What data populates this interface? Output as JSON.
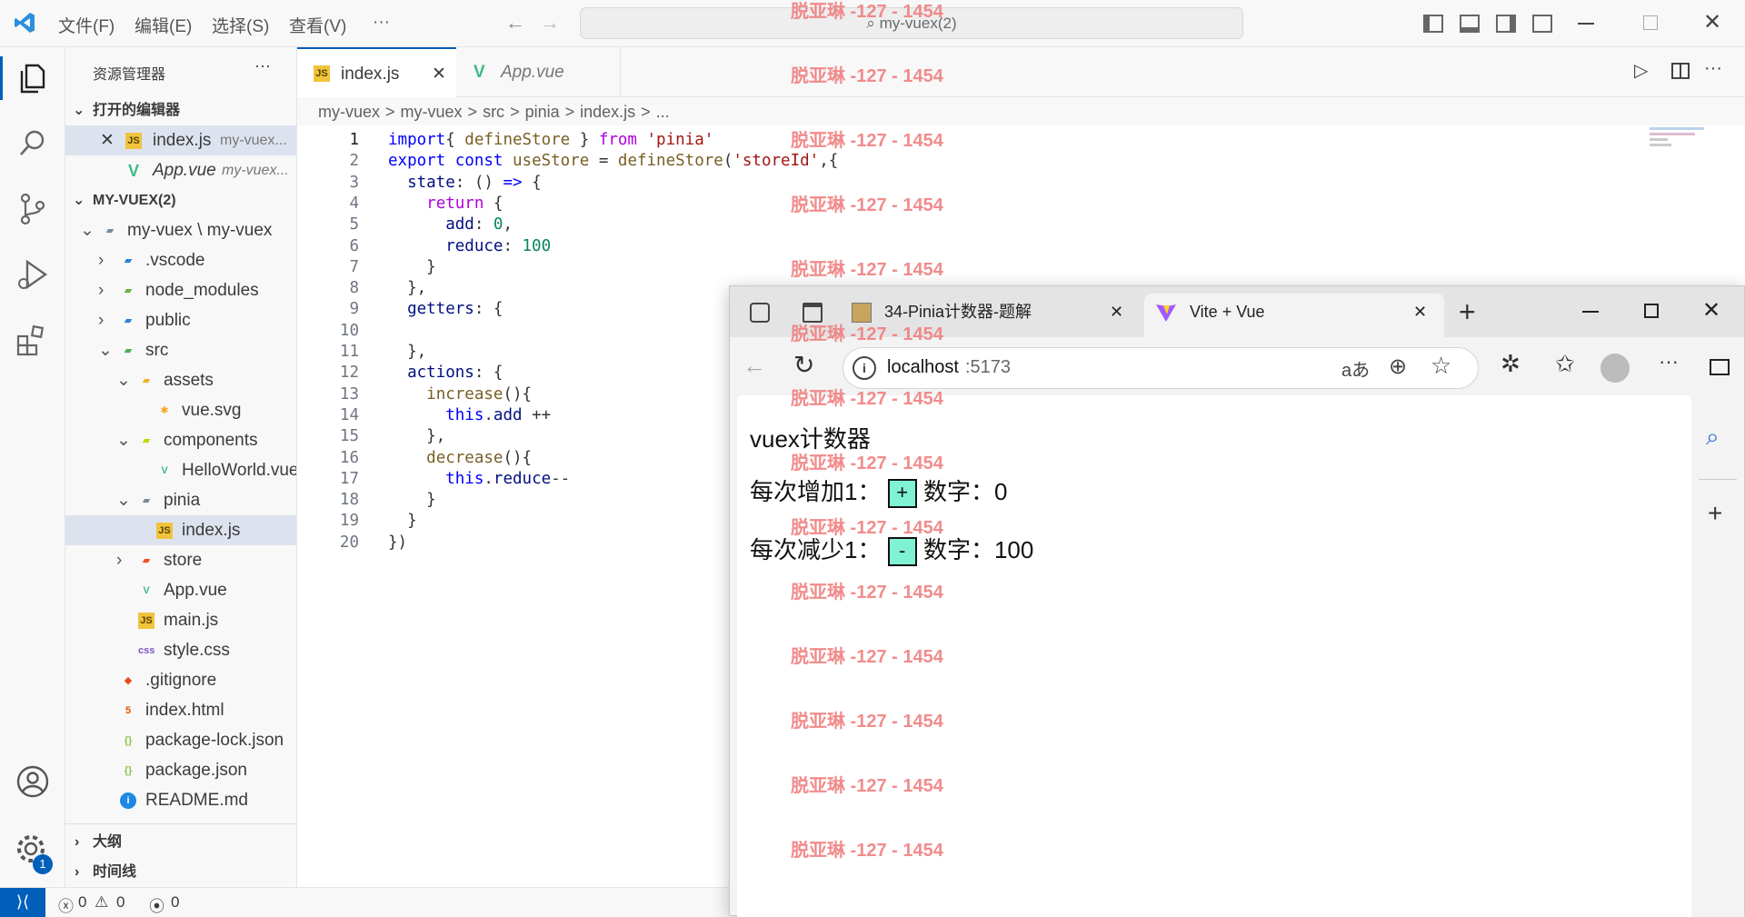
{
  "titlebar": {
    "menus": [
      "文件(F)",
      "编辑(E)",
      "选择(S)",
      "查看(V)",
      "···"
    ],
    "search": "my-vuex(2)"
  },
  "sidebar": {
    "title": "资源管理器",
    "more": "···",
    "open_editors_header": "打开的编辑器",
    "open_editors": [
      {
        "name": "index.js",
        "path": "my-vuex..."
      },
      {
        "name": "App.vue",
        "path": "my-vuex..."
      }
    ],
    "project_header": "MY-VUEX(2)",
    "tree": [
      {
        "label": "my-vuex \\ my-vuex",
        "depth": 1,
        "chev": "v",
        "icon": "folder",
        "color": "#7a8b99"
      },
      {
        "label": ".vscode",
        "depth": 2,
        "chev": ">",
        "icon": "folder",
        "color": "#2f7fd8"
      },
      {
        "label": "node_modules",
        "depth": 2,
        "chev": ">",
        "icon": "folder",
        "color": "#6cb33f"
      },
      {
        "label": "public",
        "depth": 2,
        "chev": ">",
        "icon": "folder",
        "color": "#2f7fd8"
      },
      {
        "label": "src",
        "depth": 2,
        "chev": "v",
        "icon": "folder",
        "color": "#4caf50"
      },
      {
        "label": "assets",
        "depth": 3,
        "chev": "v",
        "icon": "folder",
        "color": "#f0b429"
      },
      {
        "label": "vue.svg",
        "depth": 4,
        "chev": "",
        "icon": "star",
        "color": "#f5a623"
      },
      {
        "label": "components",
        "depth": 3,
        "chev": "v",
        "icon": "folder",
        "color": "#c4d600"
      },
      {
        "label": "HelloWorld.vue",
        "depth": 4,
        "chev": "",
        "icon": "vue",
        "color": "#41b883"
      },
      {
        "label": "pinia",
        "depth": 3,
        "chev": "v",
        "icon": "folder",
        "color": "#7a8b99"
      },
      {
        "label": "index.js",
        "depth": 4,
        "chev": "",
        "icon": "js",
        "color": "#f0c33c",
        "selected": true
      },
      {
        "label": "store",
        "depth": 3,
        "chev": ">",
        "icon": "folder",
        "color": "#f4511e"
      },
      {
        "label": "App.vue",
        "depth": 3,
        "chev": "",
        "icon": "vue",
        "color": "#41b883"
      },
      {
        "label": "main.js",
        "depth": 3,
        "chev": "",
        "icon": "js",
        "color": "#f0c33c"
      },
      {
        "label": "style.css",
        "depth": 3,
        "chev": "",
        "icon": "css",
        "color": "#7e57c2"
      },
      {
        "label": ".gitignore",
        "depth": 2,
        "chev": "",
        "icon": "git",
        "color": "#e64a19"
      },
      {
        "label": "index.html",
        "depth": 2,
        "chev": "",
        "icon": "html",
        "color": "#e65100"
      },
      {
        "label": "package-lock.json",
        "depth": 2,
        "chev": "",
        "icon": "json",
        "color": "#8bc34a"
      },
      {
        "label": "package.json",
        "depth": 2,
        "chev": "",
        "icon": "json",
        "color": "#8bc34a"
      },
      {
        "label": "README.md",
        "depth": 2,
        "chev": "",
        "icon": "info",
        "color": "#1e88e5"
      }
    ],
    "outline": "大纲",
    "timeline": "时间线"
  },
  "editor": {
    "tabs": [
      {
        "label": "index.js",
        "active": true
      },
      {
        "label": "App.vue",
        "active": false
      }
    ],
    "breadcrumb": [
      "my-vuex",
      ">",
      "my-vuex",
      ">",
      "src",
      ">",
      "pinia",
      ">",
      "index.js",
      ">",
      "..."
    ],
    "lines": [
      [
        [
          "kw",
          "import"
        ],
        [
          "",
          "{ "
        ],
        [
          "fn",
          "defineStore"
        ],
        [
          "",
          " } "
        ],
        [
          "ctl",
          "from"
        ],
        [
          "",
          " "
        ],
        [
          "str",
          "'pinia'"
        ]
      ],
      [
        [
          "kw",
          "export"
        ],
        [
          "",
          " "
        ],
        [
          "kw",
          "const"
        ],
        [
          "",
          " "
        ],
        [
          "fn",
          "useStore"
        ],
        [
          "",
          " = "
        ],
        [
          "fn",
          "defineStore"
        ],
        [
          "",
          "("
        ],
        [
          "str",
          "'storeId'"
        ],
        [
          "",
          ",{"
        ]
      ],
      [
        [
          "",
          "  "
        ],
        [
          "prop",
          "state"
        ],
        [
          "",
          ": () "
        ],
        [
          "kw",
          "=>"
        ],
        [
          "",
          " {"
        ]
      ],
      [
        [
          "",
          "    "
        ],
        [
          "ctl",
          "return"
        ],
        [
          "",
          " {"
        ]
      ],
      [
        [
          "",
          "      "
        ],
        [
          "prop",
          "add"
        ],
        [
          "",
          ": "
        ],
        [
          "num",
          "0"
        ],
        [
          "",
          ","
        ]
      ],
      [
        [
          "",
          "      "
        ],
        [
          "prop",
          "reduce"
        ],
        [
          "",
          ": "
        ],
        [
          "num",
          "100"
        ]
      ],
      [
        [
          "",
          "    }"
        ]
      ],
      [
        [
          "",
          "  },"
        ]
      ],
      [
        [
          "",
          "  "
        ],
        [
          "prop",
          "getters"
        ],
        [
          "",
          ": {"
        ]
      ],
      [
        [
          "",
          ""
        ]
      ],
      [
        [
          "",
          "  },"
        ]
      ],
      [
        [
          "",
          "  "
        ],
        [
          "prop",
          "actions"
        ],
        [
          "",
          ": {"
        ]
      ],
      [
        [
          "",
          "    "
        ],
        [
          "fn",
          "increase"
        ],
        [
          "",
          "(){"
        ]
      ],
      [
        [
          "",
          "      "
        ],
        [
          "kw",
          "this"
        ],
        [
          "",
          "."
        ],
        [
          "prop",
          "add"
        ],
        [
          "",
          " ++"
        ]
      ],
      [
        [
          "",
          "    },"
        ]
      ],
      [
        [
          "",
          "    "
        ],
        [
          "fn",
          "decrease"
        ],
        [
          "",
          "(){"
        ]
      ],
      [
        [
          "",
          "      "
        ],
        [
          "kw",
          "this"
        ],
        [
          "",
          "."
        ],
        [
          "prop",
          "reduce"
        ],
        [
          "",
          "--"
        ]
      ],
      [
        [
          "",
          "    }"
        ]
      ],
      [
        [
          "",
          "  }"
        ]
      ],
      [
        [
          "",
          "})"
        ]
      ]
    ]
  },
  "status": {
    "errors": "0",
    "warnings": "0",
    "ports": "0",
    "badge": "1"
  },
  "browser": {
    "tabs": [
      {
        "label": "34-Pinia计数器-题解"
      },
      {
        "label": "Vite + Vue"
      }
    ],
    "url_host": "localhost",
    "url_port": ":5173",
    "page": {
      "title": "vuex计数器",
      "inc_label": "每次增加1：",
      "inc_btn": "+",
      "inc_num_label": "数字：",
      "inc_value": "0",
      "dec_label": "每次减少1：",
      "dec_btn": "-",
      "dec_num_label": "数字：",
      "dec_value": "100"
    }
  },
  "watermark": "脱亚琳 -127 - 1454"
}
